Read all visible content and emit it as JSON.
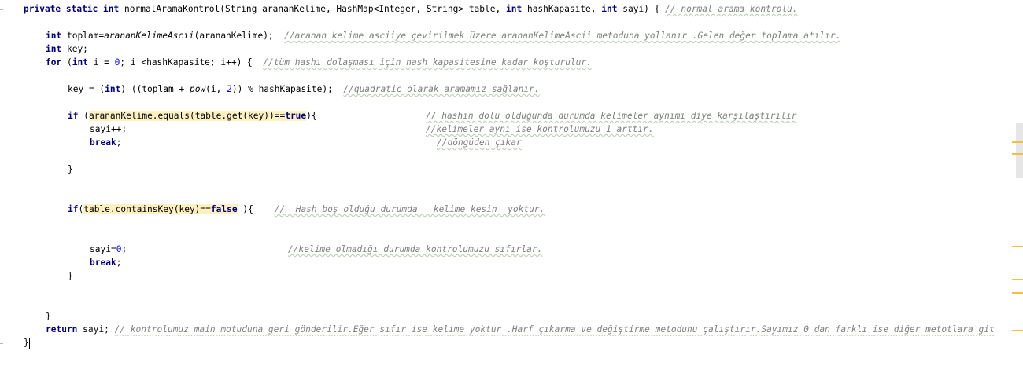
{
  "code": {
    "line1": {
      "kw1": "private static int",
      "method_name": "normalAramaKontrol",
      "params_a": "(String arananKelime, HashMap<Integer, String> table,",
      "kw_int1": "int",
      "param_hk": "hashKapasite,",
      "kw_int2": "int",
      "param_sayi": "sayi) {",
      "comment": "// normal arama kontrolu."
    },
    "line2": {
      "kw": "int",
      "text_a": "toplam=",
      "call": "arananKelimeAscii",
      "text_b": "(arananKelime);",
      "comment": "//aranan kelime asciiye çevirilmek üzere arananKelimeAscii metoduna yollanır .Gelen değer toplama atılır."
    },
    "line3": {
      "kw": "int",
      "text": "key;"
    },
    "line4": {
      "kw": "for",
      "text_a": "(",
      "kw_int": "int",
      "text_b": "i =",
      "num0": "0",
      "text_c": "; i <hashKapasite; i++) {",
      "comment": "//tüm hashı dolaşması için hash kapasitesine kadar koşturulur."
    },
    "line5": {
      "text_a": "key = (",
      "kw_int": "int",
      "text_b": ") ((toplam +",
      "pow": "pow",
      "text_c": "(i,",
      "num2": "2",
      "text_d": ")) % hashKapasite);",
      "comment": "//quadratic olarak aramamız sağlanır."
    },
    "line6": {
      "kw_if": "if",
      "text_a": "(",
      "hl_text": "arananKelime.equals(table.get(key))==",
      "kw_true": "true",
      "text_b": "){",
      "comment": "// hashın dolu olduğunda durumda kelimeler aynımı diye karşılaştırılır"
    },
    "line7": {
      "text": "sayi++;",
      "comment": "//kelimeler aynı ise kontrolumuzu 1 arttır."
    },
    "line8": {
      "kw": "break",
      "text": ";",
      "comment": "//döngüden çıkar"
    },
    "line9": {
      "text": "}"
    },
    "line10": {
      "kw_if": "if",
      "text_a": "(",
      "hl_text": "table.containsKey(key)==",
      "kw_false": "false",
      "text_b": "){",
      "comment": "//  Hash boş olduğu durumda   kelime kesin  yoktur."
    },
    "line11": {
      "text_a": "sayi=",
      "num0": "0",
      "text_b": ";",
      "comment": "//kelime olmadığı durumda kontrolumuzu sıfırlar."
    },
    "line12": {
      "kw": "break",
      "text": ";"
    },
    "line13": {
      "text": "}"
    },
    "line14": {
      "text": "}"
    },
    "line15": {
      "kw": "return",
      "text": "sayi;",
      "comment": "// kontrolumuz main motuduna geri gönderilir.Eğer sıfır ise kelime yoktur .Harf çıkarma ve değiştirme metodunu çalıştırır.Sayımız 0 dan farklı ise diğer metotlara git"
    },
    "line16": {
      "text": "}"
    }
  },
  "colors": {
    "keyword": "#000080",
    "comment": "#808080",
    "number": "#0000ff",
    "highlight": "#fdf1c2",
    "marker": "#f0c040"
  }
}
